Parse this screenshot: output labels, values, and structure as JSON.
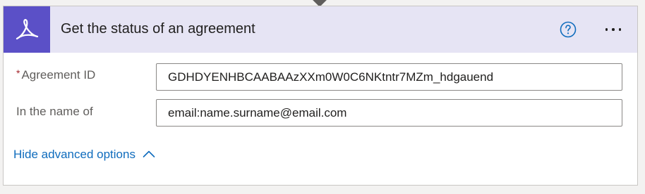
{
  "header": {
    "title": "Get the status of an agreement",
    "icons": {
      "logo": "adobe-acrobat-sign-icon",
      "help": "help-circle-icon",
      "more": "more-options-icon",
      "connector": "flow-arrow-icon"
    },
    "colors": {
      "logo_tile": "#5b50c7",
      "header_bg": "#e6e4f4",
      "help_icon": "#0f6cbd"
    }
  },
  "fields": [
    {
      "label": "Agreement ID",
      "required": "*",
      "value": "GDHDYENHBCAABAAzXXm0W0C6NKtntr7MZm_hdgauend"
    },
    {
      "label": "In the name of",
      "value": "email:name.surname@email.com"
    }
  ],
  "advanced": {
    "label": "Hide advanced options",
    "icon": "chevron-up-icon",
    "color": "#0f6cbd"
  }
}
